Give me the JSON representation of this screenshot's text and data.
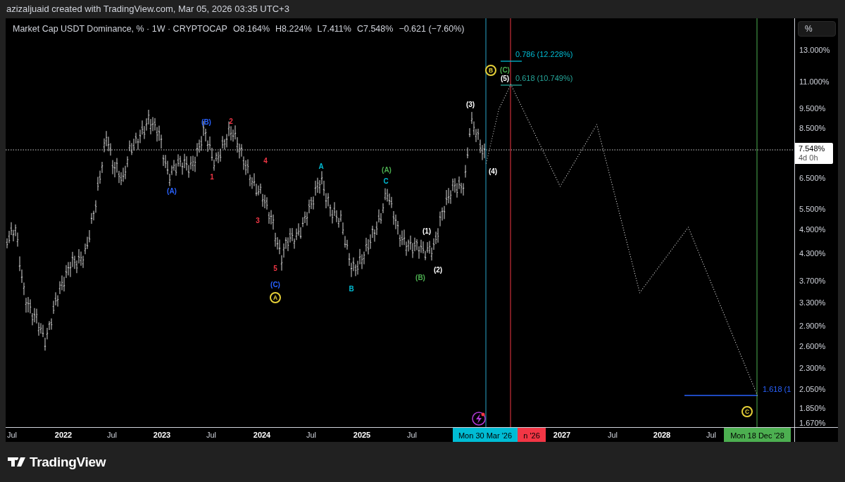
{
  "caption": "azizaljuaid created with TradingView.com, Mar 05, 2026 03:35 UTC+3",
  "legend": {
    "symbol": "Market Cap USDT Dominance, % · 1W · CRYPTOCAP",
    "values": [
      "O8.164%",
      "H8.224%",
      "L7.411%",
      "C7.548%",
      "−0.621 (−7.60%)"
    ]
  },
  "scale_button": "%",
  "price_axis": {
    "labels": [
      "13.000%",
      "11.000%",
      "9.500%",
      "8.500%",
      "6.500%",
      "5.500%",
      "4.900%",
      "4.300%",
      "3.700%",
      "3.300%",
      "2.900%",
      "2.600%",
      "2.300%",
      "2.050%",
      "1.850%",
      "1.670%"
    ],
    "current_price": "7.548%",
    "countdown": "4d 0h"
  },
  "time_axis": {
    "labels": [
      {
        "text": "Jul",
        "kind": "month"
      },
      {
        "text": "2022",
        "kind": "year"
      },
      {
        "text": "Jul",
        "kind": "month"
      },
      {
        "text": "2023",
        "kind": "year"
      },
      {
        "text": "Jul",
        "kind": "month"
      },
      {
        "text": "2024",
        "kind": "year"
      },
      {
        "text": "Jul",
        "kind": "month"
      },
      {
        "text": "2025",
        "kind": "year"
      },
      {
        "text": "Jul",
        "kind": "month"
      },
      {
        "text": "2027",
        "kind": "year"
      },
      {
        "text": "Jul",
        "kind": "month"
      },
      {
        "text": "2028",
        "kind": "year"
      },
      {
        "text": "Jul",
        "kind": "month"
      }
    ],
    "markers": [
      {
        "text": "Mon 30 Mar '26",
        "color": "#00bcd4"
      },
      {
        "text": "n '26",
        "color": "#f23645"
      },
      {
        "text": "Mon 18 Dec '28",
        "color": "#4caf50"
      }
    ]
  },
  "wave_labels": [
    {
      "text": "(A)",
      "color": "#2962ff",
      "kind": "plain"
    },
    {
      "text": "(B)",
      "color": "#2962ff",
      "kind": "plain"
    },
    {
      "text": "1",
      "color": "#f23645",
      "kind": "plain"
    },
    {
      "text": "2",
      "color": "#f23645",
      "kind": "plain"
    },
    {
      "text": "4",
      "color": "#f23645",
      "kind": "plain"
    },
    {
      "text": "3",
      "color": "#f23645",
      "kind": "plain"
    },
    {
      "text": "5",
      "color": "#f23645",
      "kind": "plain"
    },
    {
      "text": "(C)",
      "color": "#2962ff",
      "kind": "plain"
    },
    {
      "text": "A",
      "color": "#e6d038",
      "kind": "circled"
    },
    {
      "text": "A",
      "color": "#00bcd4",
      "kind": "plain"
    },
    {
      "text": "B",
      "color": "#00bcd4",
      "kind": "plain"
    },
    {
      "text": "(A)",
      "color": "#4caf50",
      "kind": "plain"
    },
    {
      "text": "C",
      "color": "#00bcd4",
      "kind": "plain"
    },
    {
      "text": "(B)",
      "color": "#4caf50",
      "kind": "plain"
    },
    {
      "text": "(1)",
      "color": "#ffffff",
      "kind": "plain"
    },
    {
      "text": "(2)",
      "color": "#ffffff",
      "kind": "plain"
    },
    {
      "text": "(3)",
      "color": "#ffffff",
      "kind": "plain"
    },
    {
      "text": "(4)",
      "color": "#ffffff",
      "kind": "plain"
    },
    {
      "text": "B",
      "color": "#e6d038",
      "kind": "circled"
    },
    {
      "text": "(C)",
      "color": "#4caf50",
      "kind": "plain"
    },
    {
      "text": "(5)",
      "color": "#ffffff",
      "kind": "plain"
    },
    {
      "text": "C",
      "color": "#e6d038",
      "kind": "circled"
    }
  ],
  "fib_levels": [
    {
      "text": "0.786 (12.228%)",
      "color": "#00bcd4"
    },
    {
      "text": "0.618 (10.749%)",
      "color": "#26a69a"
    },
    {
      "text": "1.618 (1",
      "color": "#2962ff"
    }
  ],
  "footer": {
    "logo_text": "TradingView"
  }
}
